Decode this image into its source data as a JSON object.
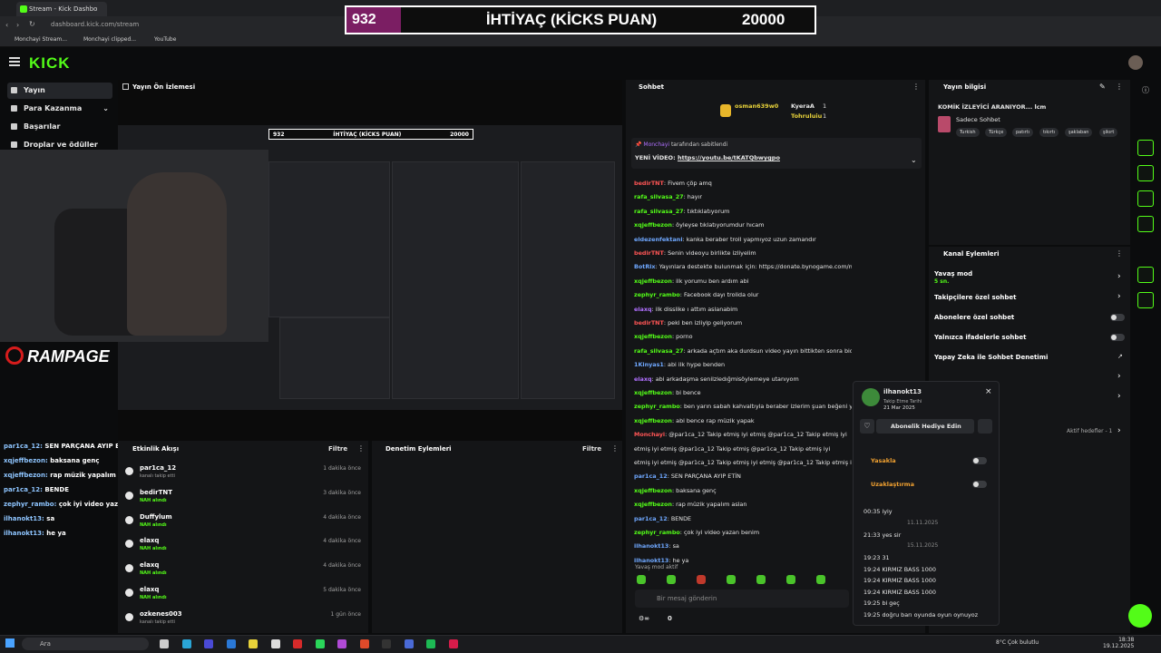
{
  "browser": {
    "tab_title": "Stream - Kick Dashbo",
    "url": "dashboard.kick.com/stream",
    "bookmarks": [
      "Monchayi Stream...",
      "Monchayi clipped...",
      "YouTube"
    ]
  },
  "overlay": {
    "current": "932",
    "title": "İHTİYAÇ (KİCKS PUAN)",
    "goal": "20000"
  },
  "kick": {
    "logo": "KICK"
  },
  "sidebar": {
    "items": [
      "Yayın",
      "Para Kazanma",
      "Başarılar",
      "Droplar ve ödüller"
    ]
  },
  "preview": {
    "title": "Yayın Ön İzlemesi",
    "brand": "RAMPAGE"
  },
  "overlay_chat": [
    {
      "user": "par1ca_12:",
      "text": " SEN PARÇANA AYIP ETİN"
    },
    {
      "user": "xqjeffbezon:",
      "text": " baksana genç"
    },
    {
      "user": "xqjeffbezon:",
      "text": " rap müzik yapalım aslan"
    },
    {
      "user": "par1ca_12:",
      "text": " BENDE"
    },
    {
      "user": "zephyr_rambo:",
      "text": " çok iyi video yazan benim"
    },
    {
      "user": "ilhanokt13:",
      "text": " sa"
    },
    {
      "user": "ilhanokt13:",
      "text": " he ya"
    }
  ],
  "activity": {
    "title": "Etkinlik Akışı",
    "filter": "Filtre",
    "rows": [
      {
        "name": "par1ca_12",
        "sub": "kanalı takip etti",
        "time": "1 dakika önce",
        "green": false
      },
      {
        "name": "bedirTNT",
        "sub": "NAH alındı",
        "time": "3 dakika önce",
        "green": true
      },
      {
        "name": "Duffylum",
        "sub": "NAH alındı",
        "time": "4 dakika önce",
        "green": true
      },
      {
        "name": "elaxq",
        "sub": "NAH alındı",
        "time": "4 dakika önce",
        "green": true
      },
      {
        "name": "elaxq",
        "sub": "NAH alındı",
        "time": "4 dakika önce",
        "green": true
      },
      {
        "name": "elaxq",
        "sub": "NAH alındı",
        "time": "5 dakika önce",
        "green": true
      },
      {
        "name": "ozkenes003",
        "sub": "kanalı takip etti",
        "time": "1 gün önce",
        "green": false
      }
    ]
  },
  "moderation": {
    "title": "Denetim Eylemleri",
    "filter": "Filtre"
  },
  "chat": {
    "title": "Sohbet",
    "top_users": [
      "osman639w0",
      "KyeraA",
      "Tohruluiu"
    ],
    "top_counts": [
      "1",
      "1"
    ],
    "pinned_by": "Monchayi",
    "pinned_label": " tarafından sabitlendi",
    "pinned_text": "YENİ VİDEO: ",
    "pinned_link": "https://youtu.be/tKATQbwygpo",
    "messages": [
      {
        "user": "bedirTNT",
        "cls": "cr",
        "text": ": Fivem çöp amq"
      },
      {
        "user": "rafa_silvasa_27",
        "cls": "cg",
        "text": ": hayır"
      },
      {
        "user": "rafa_silvasa_27",
        "cls": "cg",
        "text": ": tıktıklatıyorum"
      },
      {
        "user": "xqjeffbezon",
        "cls": "cg",
        "text": ": öyleyse tıklatıyorumdur hıcam"
      },
      {
        "user": "eldezenfektani",
        "cls": "cb",
        "text": ": kanka beraber troll yapmıyoz uzun zamandır"
      },
      {
        "user": "bedirTNT",
        "cls": "cr",
        "text": ": Senin videoyu birlikte izliyelim"
      },
      {
        "user": "BotRix",
        "cls": "cb",
        "text": ": Yayınlara destekte bulunmak için: https://donate.bynogame.com/monchayi"
      },
      {
        "user": "xqjeffbezon",
        "cls": "cg",
        "text": ": ilk yorumu ben ardım abi"
      },
      {
        "user": "zephyr_rambo",
        "cls": "cg",
        "text": ": Facebook dayı trolida olur"
      },
      {
        "user": "elaxq",
        "cls": "cp",
        "text": ": ilk disslike ı attım aslanabim"
      },
      {
        "user": "bedirTNT",
        "cls": "cr",
        "text": ": peki ben izliylp geliyorum"
      },
      {
        "user": "xqjeffbezon",
        "cls": "cg",
        "text": ": porno"
      },
      {
        "user": "rafa_silvasa_27",
        "cls": "cg",
        "text": ": arkada açtım aka durdsun video yayın bittikten sonra bidaha izlerim"
      },
      {
        "user": "1Kinyas1",
        "cls": "cb",
        "text": ": abi ilk hype benden"
      },
      {
        "user": "elaxq",
        "cls": "cp",
        "text": ": abi arkadaşma senilzledığmisöylemeye utanıyom"
      },
      {
        "user": "xqjeffbezon",
        "cls": "cg",
        "text": ": bi bence"
      },
      {
        "user": "zephyr_rambo",
        "cls": "cg",
        "text": ": ben yarın sabah kahvaltıyla beraber izlerim şuan beğeni yor"
      },
      {
        "user": "xqjeffbezon",
        "cls": "cg",
        "text": ": abi bence rap müzik yapak"
      },
      {
        "user": "Monchayi",
        "cls": "cr",
        "text": ": @par1ca_12 Takip etmiş iyi etmiş @par1ca_12 Takip etmiş iyi"
      },
      {
        "user": "",
        "cls": "",
        "text": "etmiş iyi etmiş @par1ca_12 Takip etmiş @par1ca_12 Takip etmiş iyi"
      },
      {
        "user": "",
        "cls": "",
        "text": "etmiş iyi etmiş @par1ca_12 Takip etmiş iyi etmiş @par1ca_12 Takip etmiş iyi"
      },
      {
        "user": "par1ca_12",
        "cls": "cb",
        "text": ": SEN PARÇANA AYIP ETİN"
      },
      {
        "user": "xqjeffbezon",
        "cls": "cg",
        "text": ": baksana genç"
      },
      {
        "user": "xqjeffbezon",
        "cls": "cg",
        "text": ": rap müzik yapalım aslan"
      },
      {
        "user": "par1ca_12",
        "cls": "cb",
        "text": ": BENDE"
      },
      {
        "user": "zephyr_rambo",
        "cls": "cg",
        "text": ": çok iyi video yazan benim"
      },
      {
        "user": "ilhanokt13",
        "cls": "cb",
        "text": ": sa"
      },
      {
        "user": "ilhanokt13",
        "cls": "cb",
        "text": ": he ya"
      }
    ],
    "slow_mode": "Yavaş mod aktif",
    "input_placeholder": "Bir mesaj gönderin",
    "footer_count": "0"
  },
  "stream_info": {
    "title": "Yayın bilgisi",
    "stream_title": "KOMİK İZLEYİCİ ARANIYOR... lcm",
    "category": "Sadece Sohbet",
    "tags": [
      "Turkish",
      "Türkçe",
      "patırtı",
      "tıkırtı",
      "şaklaban",
      "şikırt"
    ]
  },
  "channel_actions": {
    "title": "Kanal Eylemleri",
    "slow_mode": "Yavaş mod",
    "slow_mode_value": "5 sn.",
    "followers_only": "Takipçilere özel sohbet",
    "subscribers_only": "Abonelere özel sohbet",
    "emote_only": "Yalnızca ifadelerle sohbet",
    "ai_moderation": "Yapay Zeka ile Sohbet Denetimi",
    "active_goals": "Aktif hedefler - 1"
  },
  "user_popup": {
    "username": "ilhanokt13",
    "follow_label": "Takip Etme Tarihi",
    "follow_date": "21 Mar 2025",
    "gift_button": "Abonelik Hediye Edin",
    "ban": "Yasakla",
    "timeout": "Uzaklaştırma",
    "history": [
      {
        "type": "msg",
        "text": "00:35 iyiy"
      },
      {
        "type": "date",
        "text": "11.11.2025"
      },
      {
        "type": "msg",
        "text": "21:33 yes sir"
      },
      {
        "type": "date",
        "text": "15.11.2025"
      },
      {
        "type": "msg",
        "text": "19:23 31"
      },
      {
        "type": "msg",
        "text": "19:24 KIRMIZ BASS 1000"
      },
      {
        "type": "msg",
        "text": "19:24 KIRMIZ BASS 1000"
      },
      {
        "type": "msg",
        "text": "19:24 KIRMIZ BASS 1000"
      },
      {
        "type": "msg",
        "text": "19:25 bi geç"
      },
      {
        "type": "msg",
        "text": "19:25 doğru barı oyunda oyun oynuyoz"
      }
    ]
  },
  "taskbar": {
    "search": "Ara",
    "weather": "8°C  Çok bulutlu",
    "time": "18:38",
    "date": "19.12.2025"
  },
  "colors": {
    "accent": "#53fc18",
    "overlay_value_bg": "#7b1e63",
    "panel_bg": "#141517"
  }
}
